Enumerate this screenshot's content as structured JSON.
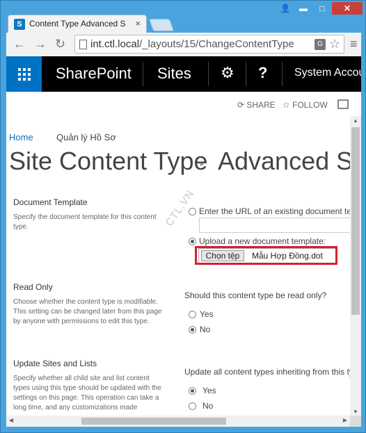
{
  "browser": {
    "tab_title": "Content Type Advanced S",
    "tab_favicon": "S",
    "tab_close": "×",
    "url_host": "int.ctl.local",
    "url_path": "/_layouts/15/ChangeContentType",
    "back_icon": "←",
    "forward_icon": "→",
    "reload_icon": "↻",
    "star_icon": "☆",
    "menu_icon": "≡",
    "translate_icon": "G",
    "window_controls": {
      "user": "👤",
      "minimize": "▬",
      "maximize": "□",
      "close": "✕"
    }
  },
  "suite_bar": {
    "brand": "SharePoint",
    "sites": "Sites",
    "gear": "⚙",
    "help": "?",
    "account": "System Accoun"
  },
  "actions": {
    "share": "SHARE",
    "follow": "FOLLOW",
    "share_icon": "⟳",
    "follow_icon": "☆"
  },
  "breadcrumb": {
    "home": "Home",
    "site": "Quản lý Hồ Sơ"
  },
  "page": {
    "title": "Site Content Type",
    "separator": "▸",
    "subtitle": "Advanced Se"
  },
  "watermark": "CTL.VN",
  "sections": {
    "document_template": {
      "heading": "Document Template",
      "description": "Specify the document template for this content type.",
      "url_option": "Enter the URL of an existing document ter",
      "upload_option": "Upload a new document template:",
      "choose_file": "Chọn tệp",
      "file_name": "Mẫu Hợp Đồng.dot"
    },
    "read_only": {
      "heading": "Read Only",
      "description": "Choose whether the content type is modifiable. This setting can be changed later from this page by anyone with permissions to edit this type.",
      "question": "Should this content type be read only?",
      "yes": "Yes",
      "no": "No"
    },
    "update_sites": {
      "heading": "Update Sites and Lists",
      "description": "Specify whether all child site and list content types using this type should be updated with the settings on this page. This operation can take a long time, and any customizations made",
      "question": "Update all content types inheriting from this ty",
      "yes": "Yes",
      "no": "No"
    }
  },
  "scrollbars": {
    "up": "▲",
    "down": "▼",
    "left": "◀",
    "right": "▶"
  }
}
